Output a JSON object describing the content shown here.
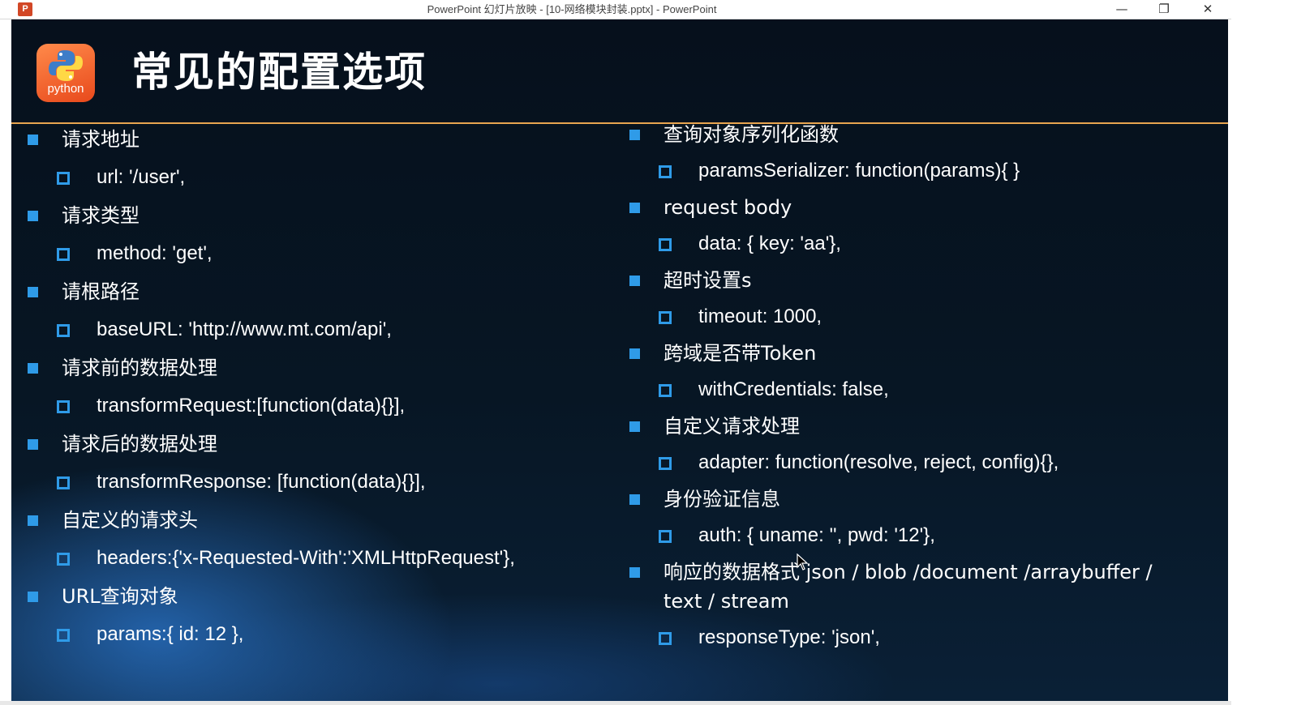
{
  "window": {
    "title": "PowerPoint 幻灯片放映 - [10-网络模块封装.pptx] - PowerPoint",
    "app_icon": "powerpoint-icon",
    "controls": {
      "minimize": "—",
      "restore": "❐",
      "close": "✕"
    }
  },
  "slide": {
    "logo": {
      "icon": "python-logo-icon",
      "text": "python"
    },
    "title": "常见的配置选项",
    "accent_rule_color": "#e8a550",
    "bullet_color": "#2f9be8",
    "left_column": [
      {
        "heading": "请求地址",
        "value": "url: '/user',"
      },
      {
        "heading": "请求类型",
        "value": "method: 'get',"
      },
      {
        "heading": "请根路径",
        "value": "baseURL: 'http://www.mt.com/api',"
      },
      {
        "heading": "请求前的数据处理",
        "value": "transformRequest:[function(data){}],"
      },
      {
        "heading": "请求后的数据处理",
        "value": "transformResponse: [function(data){}],"
      },
      {
        "heading": "自定义的请求头",
        "value": "headers:{'x-Requested-With':'XMLHttpRequest'},"
      },
      {
        "heading": "URL查询对象",
        "value": "params:{ id: 12 },"
      }
    ],
    "right_column": [
      {
        "heading": "查询对象序列化函数",
        "value": "paramsSerializer: function(params){ }"
      },
      {
        "heading": "request body",
        "value": "data: { key: 'aa'},"
      },
      {
        "heading": "超时设置s",
        "value": "timeout: 1000,"
      },
      {
        "heading": "跨域是否带Token",
        "value": "withCredentials: false,"
      },
      {
        "heading": "自定义请求处理",
        "value": "adapter: function(resolve, reject, config){},"
      },
      {
        "heading": "身份验证信息",
        "value": "auth: { uname: '', pwd: '12'},"
      },
      {
        "heading": "响应的数据格式 json / blob /document /arraybuffer / text / stream",
        "value": "responseType: 'json',"
      }
    ]
  }
}
